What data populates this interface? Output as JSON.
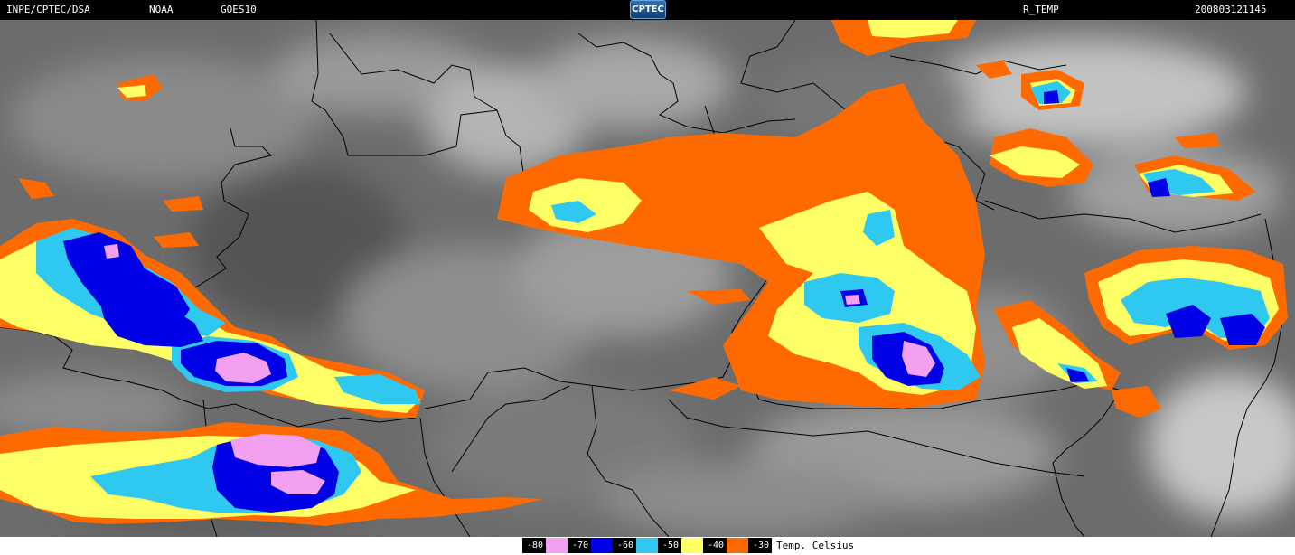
{
  "header": {
    "source": "INPE/CPTEC/DSA",
    "agency": "NOAA",
    "satellite": "GOES10",
    "logo": "CPTEC",
    "product": "R_TEMP",
    "datetime": "200803121145"
  },
  "legend": {
    "unit": "Temp. Celsius",
    "entries": [
      {
        "label": "-80",
        "color": "#f4a0f0"
      },
      {
        "label": "-70",
        "color": "#0000e6"
      },
      {
        "label": "-60",
        "color": "#2ec8f0"
      },
      {
        "label": "-50",
        "color": "#ffff66"
      },
      {
        "label": "-40",
        "color": "#ff6a00"
      },
      {
        "label": "-30",
        "color": "#000000"
      }
    ]
  },
  "map": {
    "colors": {
      "background": "#6c6c6c",
      "border": "#000000",
      "border_white": "#ffffff"
    }
  }
}
